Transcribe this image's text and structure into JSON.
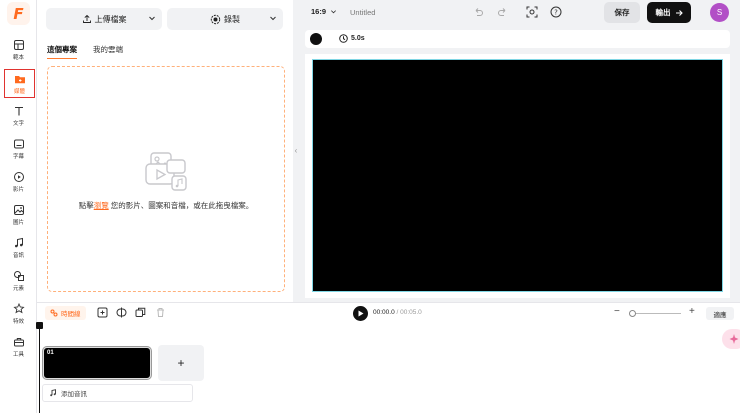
{
  "rail": {
    "logo_letter": "F",
    "items": [
      {
        "label": "範本",
        "icon": "template-icon"
      },
      {
        "label": "媒體",
        "icon": "media-folder-icon"
      },
      {
        "label": "文字",
        "icon": "text-icon"
      },
      {
        "label": "字幕",
        "icon": "subtitle-icon"
      },
      {
        "label": "影片",
        "icon": "video-icon"
      },
      {
        "label": "圖片",
        "icon": "image-icon"
      },
      {
        "label": "音訊",
        "icon": "audio-icon"
      },
      {
        "label": "元素",
        "icon": "elements-icon"
      },
      {
        "label": "特效",
        "icon": "effects-icon"
      },
      {
        "label": "工具",
        "icon": "toolbox-icon"
      }
    ],
    "active_index": 1
  },
  "panel": {
    "upload_label": "上傳檔案",
    "record_label": "錄製",
    "tabs": [
      "這個專案",
      "我的雲端"
    ],
    "active_tab": 0,
    "drop_text_before": "點擊",
    "drop_link": "瀏覽",
    "drop_text_after": " 您的影片、圖案和音檔，或在此拖曳檔案。"
  },
  "topbar": {
    "ratio": "16:9",
    "title": "Untitled",
    "save_label": "保存",
    "export_label": "輸出",
    "avatar_initial": "S"
  },
  "canvas": {
    "duration": "5.0s",
    "background_color": "#000000"
  },
  "timeline": {
    "timeline_button": "時間線",
    "current_time": "00:00.0",
    "separator": " / ",
    "total_time": "00:05.0",
    "fit_label": "適應",
    "clip_number": "01",
    "add_audio_label": "添加音訊",
    "zoom_level": 0
  },
  "colors": {
    "accent": "#ff6a1f",
    "export_bg": "#111111",
    "avatar_bg": "#b24fc6",
    "canvas_border": "#7fd6e4"
  }
}
